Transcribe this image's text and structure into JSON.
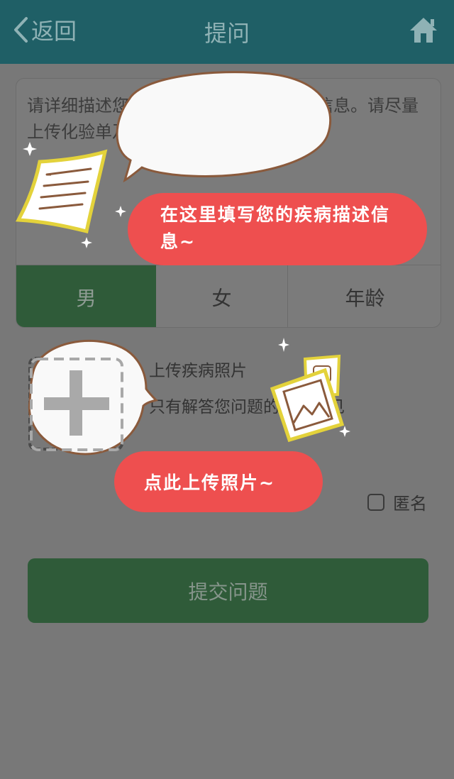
{
  "header": {
    "back_label": "返回",
    "title": "提问"
  },
  "description": {
    "placeholder": "请详细描述您的健康问题，疾病症状等信息。请尽量上传化验单及患病部位照片。"
  },
  "gender_tabs": [
    {
      "label": "男",
      "selected": true
    },
    {
      "label": "女",
      "selected": false
    }
  ],
  "age_label": "年龄",
  "upload": {
    "title": "上传疾病照片",
    "note": "只有解答您问题的医生可见"
  },
  "anonymous": {
    "label": "匿名",
    "checked": false
  },
  "submit_label": "提交问题",
  "tutorial": {
    "description_tip": "在这里填写您的疾病描述信息~",
    "upload_tip": "点此上传照片~"
  },
  "colors": {
    "header_bg": "#1f5f66",
    "dim_overlay": "#787878",
    "accent_green": "#2f5b39",
    "tip_red": "#ee4f4f"
  },
  "icons": [
    "chevron-left-icon",
    "home-icon",
    "plus-icon",
    "document-icon",
    "photo-icon",
    "sparkle-icon"
  ]
}
